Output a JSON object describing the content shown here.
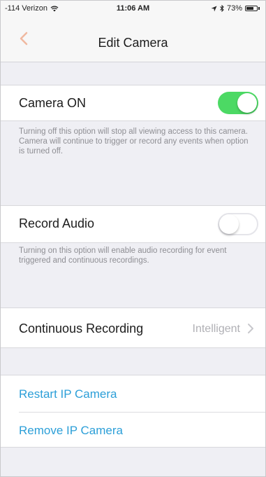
{
  "status_bar": {
    "carrier": "-114 Verizon",
    "time": "11:06 AM",
    "battery": "73%"
  },
  "nav": {
    "title": "Edit Camera",
    "back_icon": "chevron-left-icon"
  },
  "colors": {
    "accent": "#2c9fd8",
    "toggle_on": "#4cd964",
    "footer_text": "#8e8e93",
    "grouped_background": "#efeff4"
  },
  "camera_on": {
    "label": "Camera ON",
    "enabled": true,
    "footer": "Turning off this option will stop all viewing access to this camera. Camera will continue to trigger or record any events when option is turned off."
  },
  "record_audio": {
    "label": "Record Audio",
    "enabled": false,
    "footer": "Turning on this option will enable audio recording for event triggered and continuous recordings."
  },
  "continuous_recording": {
    "label": "Continuous Recording",
    "value": "Intelligent"
  },
  "actions": {
    "restart": "Restart IP Camera",
    "remove": "Remove IP Camera"
  }
}
